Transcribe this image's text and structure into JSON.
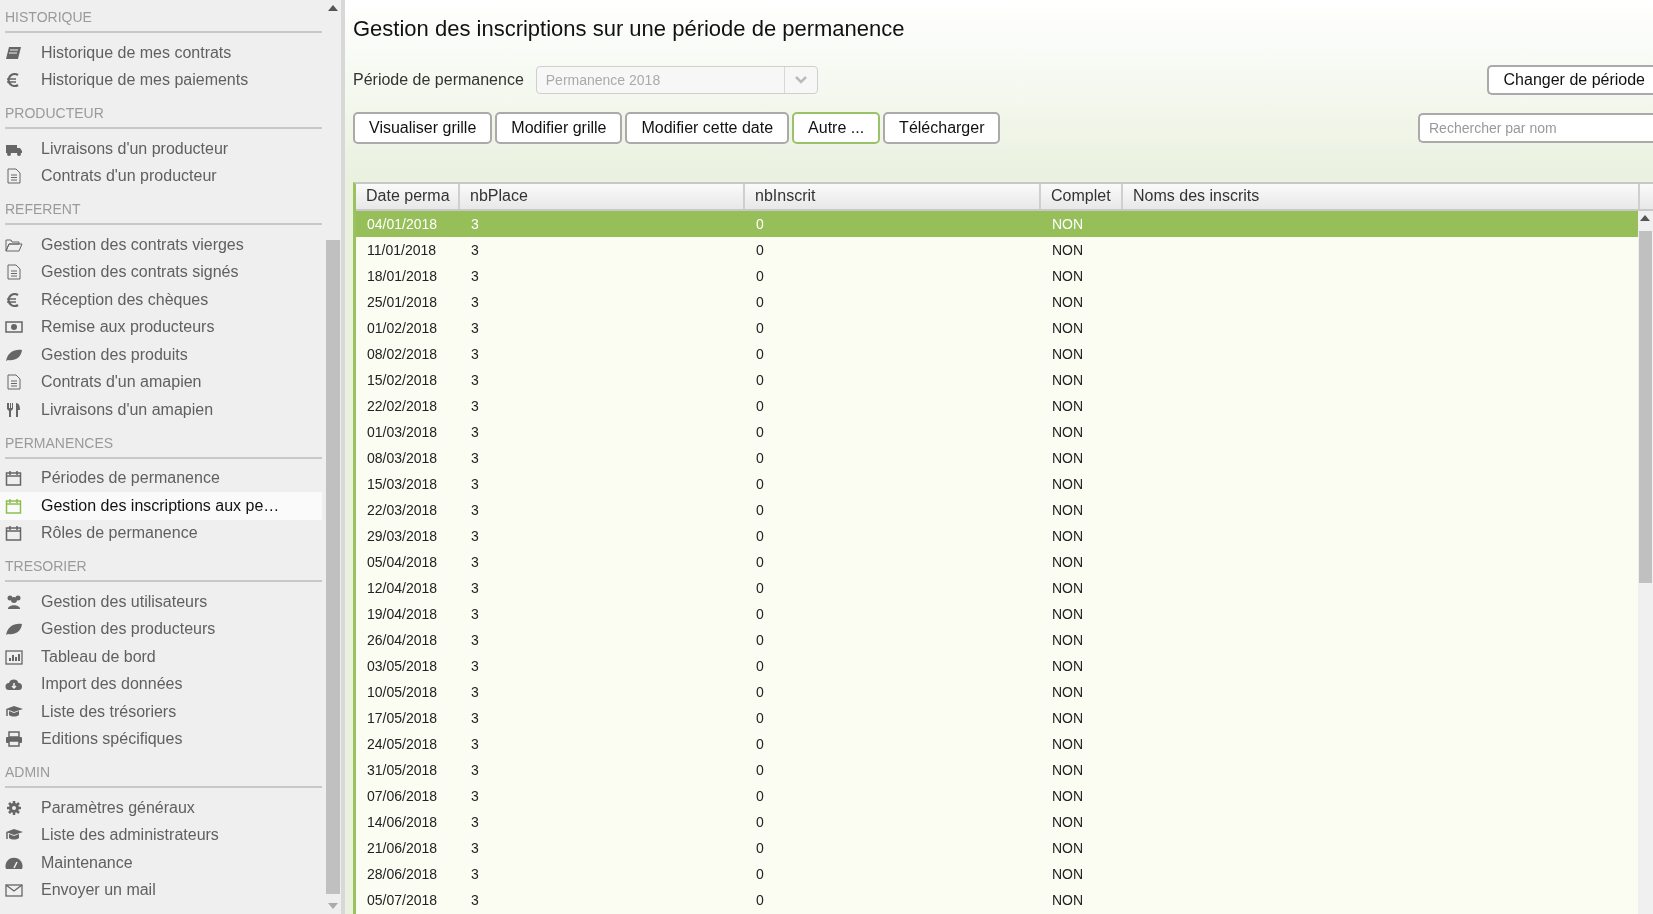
{
  "sidebar": {
    "sections": [
      {
        "title": "HISTORIQUE",
        "items": [
          {
            "label": "Historique de mes contrats",
            "selected": false
          },
          {
            "label": "Historique de mes paiements",
            "selected": false
          }
        ]
      },
      {
        "title": "PRODUCTEUR",
        "items": [
          {
            "label": "Livraisons d'un producteur",
            "selected": false
          },
          {
            "label": "Contrats d'un producteur",
            "selected": false
          }
        ]
      },
      {
        "title": "REFERENT",
        "items": [
          {
            "label": "Gestion des contrats vierges",
            "selected": false
          },
          {
            "label": "Gestion des contrats signés",
            "selected": false
          },
          {
            "label": "Réception des chèques",
            "selected": false
          },
          {
            "label": "Remise aux producteurs",
            "selected": false
          },
          {
            "label": "Gestion des produits",
            "selected": false
          },
          {
            "label": "Contrats d'un amapien",
            "selected": false
          },
          {
            "label": "Livraisons d'un amapien",
            "selected": false
          }
        ]
      },
      {
        "title": "PERMANENCES",
        "items": [
          {
            "label": "Périodes de permanence",
            "selected": false
          },
          {
            "label": "Gestion des inscriptions aux pe…",
            "selected": true
          },
          {
            "label": "Rôles de permanence",
            "selected": false
          }
        ]
      },
      {
        "title": "TRESORIER",
        "items": [
          {
            "label": "Gestion des utilisateurs",
            "selected": false
          },
          {
            "label": "Gestion des producteurs",
            "selected": false
          },
          {
            "label": "Tableau de bord",
            "selected": false
          },
          {
            "label": "Import des données",
            "selected": false
          },
          {
            "label": "Liste des trésoriers",
            "selected": false
          },
          {
            "label": "Editions spécifiques",
            "selected": false
          }
        ]
      },
      {
        "title": "ADMIN",
        "items": [
          {
            "label": "Paramètres généraux",
            "selected": false
          },
          {
            "label": "Liste des administrateurs",
            "selected": false
          },
          {
            "label": "Maintenance",
            "selected": false
          },
          {
            "label": "Envoyer un mail",
            "selected": false
          }
        ]
      }
    ]
  },
  "page": {
    "title": "Gestion des inscriptions sur une période de permanence",
    "period": {
      "label": "Période de permanence",
      "value": "Permanence 2018",
      "disabled": true
    },
    "change_button": "Changer de période",
    "buttons": [
      {
        "label": "Visualiser grille",
        "focused": false
      },
      {
        "label": "Modifier grille",
        "focused": false
      },
      {
        "label": "Modifier cette date",
        "focused": false
      },
      {
        "label": "Autre ...",
        "focused": true
      },
      {
        "label": "Télécharger",
        "focused": false
      }
    ],
    "search": {
      "placeholder": "Rechercher par nom"
    }
  },
  "table": {
    "columns": [
      "Date perma",
      "nbPlace",
      "nbInscrit",
      "Complet",
      "Noms des inscrits"
    ],
    "rows": [
      {
        "date": "04/01/2018",
        "nb_place": "3",
        "nb_inscrit": "0",
        "complet": "NON",
        "selected": true
      },
      {
        "date": "11/01/2018",
        "nb_place": "3",
        "nb_inscrit": "0",
        "complet": "NON",
        "selected": false
      },
      {
        "date": "18/01/2018",
        "nb_place": "3",
        "nb_inscrit": "0",
        "complet": "NON",
        "selected": false
      },
      {
        "date": "25/01/2018",
        "nb_place": "3",
        "nb_inscrit": "0",
        "complet": "NON",
        "selected": false
      },
      {
        "date": "01/02/2018",
        "nb_place": "3",
        "nb_inscrit": "0",
        "complet": "NON",
        "selected": false
      },
      {
        "date": "08/02/2018",
        "nb_place": "3",
        "nb_inscrit": "0",
        "complet": "NON",
        "selected": false
      },
      {
        "date": "15/02/2018",
        "nb_place": "3",
        "nb_inscrit": "0",
        "complet": "NON",
        "selected": false
      },
      {
        "date": "22/02/2018",
        "nb_place": "3",
        "nb_inscrit": "0",
        "complet": "NON",
        "selected": false
      },
      {
        "date": "01/03/2018",
        "nb_place": "3",
        "nb_inscrit": "0",
        "complet": "NON",
        "selected": false
      },
      {
        "date": "08/03/2018",
        "nb_place": "3",
        "nb_inscrit": "0",
        "complet": "NON",
        "selected": false
      },
      {
        "date": "15/03/2018",
        "nb_place": "3",
        "nb_inscrit": "0",
        "complet": "NON",
        "selected": false
      },
      {
        "date": "22/03/2018",
        "nb_place": "3",
        "nb_inscrit": "0",
        "complet": "NON",
        "selected": false
      },
      {
        "date": "29/03/2018",
        "nb_place": "3",
        "nb_inscrit": "0",
        "complet": "NON",
        "selected": false
      },
      {
        "date": "05/04/2018",
        "nb_place": "3",
        "nb_inscrit": "0",
        "complet": "NON",
        "selected": false
      },
      {
        "date": "12/04/2018",
        "nb_place": "3",
        "nb_inscrit": "0",
        "complet": "NON",
        "selected": false
      },
      {
        "date": "19/04/2018",
        "nb_place": "3",
        "nb_inscrit": "0",
        "complet": "NON",
        "selected": false
      },
      {
        "date": "26/04/2018",
        "nb_place": "3",
        "nb_inscrit": "0",
        "complet": "NON",
        "selected": false
      },
      {
        "date": "03/05/2018",
        "nb_place": "3",
        "nb_inscrit": "0",
        "complet": "NON",
        "selected": false
      },
      {
        "date": "10/05/2018",
        "nb_place": "3",
        "nb_inscrit": "0",
        "complet": "NON",
        "selected": false
      },
      {
        "date": "17/05/2018",
        "nb_place": "3",
        "nb_inscrit": "0",
        "complet": "NON",
        "selected": false
      },
      {
        "date": "24/05/2018",
        "nb_place": "3",
        "nb_inscrit": "0",
        "complet": "NON",
        "selected": false
      },
      {
        "date": "31/05/2018",
        "nb_place": "3",
        "nb_inscrit": "0",
        "complet": "NON",
        "selected": false
      },
      {
        "date": "07/06/2018",
        "nb_place": "3",
        "nb_inscrit": "0",
        "complet": "NON",
        "selected": false
      },
      {
        "date": "14/06/2018",
        "nb_place": "3",
        "nb_inscrit": "0",
        "complet": "NON",
        "selected": false
      },
      {
        "date": "21/06/2018",
        "nb_place": "3",
        "nb_inscrit": "0",
        "complet": "NON",
        "selected": false
      },
      {
        "date": "28/06/2018",
        "nb_place": "3",
        "nb_inscrit": "0",
        "complet": "NON",
        "selected": false
      },
      {
        "date": "05/07/2018",
        "nb_place": "3",
        "nb_inscrit": "0",
        "complet": "NON",
        "selected": false
      }
    ]
  }
}
